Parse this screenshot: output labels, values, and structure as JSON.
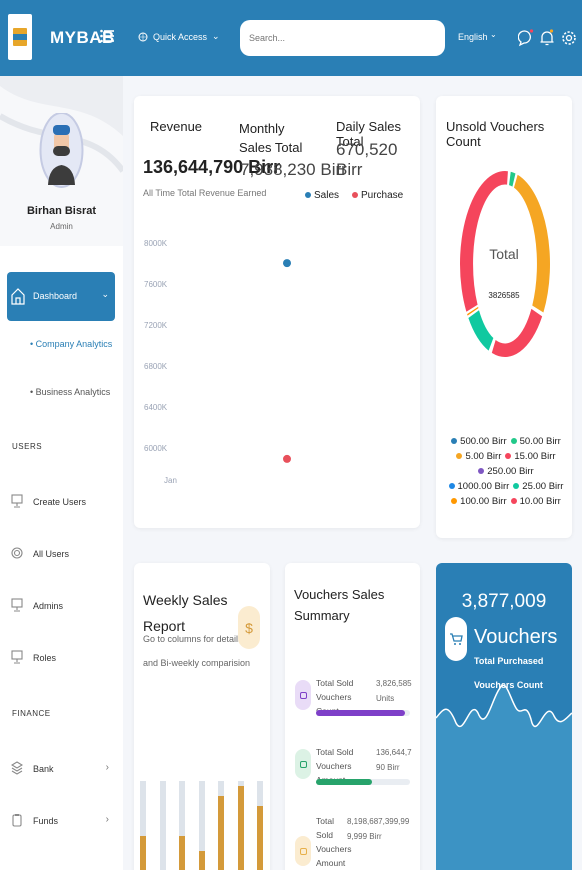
{
  "header": {
    "brand": "MYBAB",
    "quick_access": "Quick Access",
    "search_placeholder": "Search...",
    "language": "English"
  },
  "sidebar": {
    "user_name": "Birhan Bisrat",
    "user_role": "Admin",
    "dashboard_label": "Dashboard",
    "sub_items": [
      "Company Analytics",
      "Business Analytics"
    ],
    "sections": [
      "USERS",
      "FINANCE"
    ],
    "users_items": [
      "Create Users",
      "All Users",
      "Admins",
      "Roles"
    ],
    "finance_items": [
      "Bank",
      "Funds"
    ]
  },
  "revenue_card": {
    "revenue_label": "Revenue",
    "revenue_value": "136,644,790 Birr",
    "revenue_caption": "All Time Total Revenue Earned",
    "monthly_label": "Monthly Sales Total",
    "monthly_value": "7,938,230 Birr",
    "daily_label": "Daily Sales Total",
    "daily_value": "670,520 Birr"
  },
  "chart_data": [
    {
      "type": "scatter",
      "series": [
        {
          "name": "Sales",
          "color": "#2a7fb5",
          "points": [
            {
              "x": "Jan",
              "y": 7950
            }
          ]
        },
        {
          "name": "Purchase",
          "color": "#e8505b",
          "points": [
            {
              "x": "Jan",
              "y": 6040
            }
          ]
        }
      ],
      "categories": [
        "Jan"
      ],
      "y_ticks": [
        "8000K",
        "7600K",
        "7200K",
        "6800K",
        "6400K",
        "6000K"
      ],
      "ylim": [
        6000,
        8000
      ],
      "legend": "top-right",
      "grid": false
    },
    {
      "type": "pie",
      "title": "Unsold Vouchers Count",
      "center_label": "Total",
      "center_value": "3826585",
      "slices": [
        {
          "label": "500.00 Birr",
          "color": "#2a7fb5",
          "value": 0.2
        },
        {
          "label": "50.00 Birr",
          "color": "#22c98a",
          "value": 2.5
        },
        {
          "label": "5.00 Birr",
          "color": "#f5a623",
          "value": 30
        },
        {
          "label": "15.00 Birr",
          "color": "#f5455c",
          "value": 21
        },
        {
          "label": "250.00 Birr",
          "color": "#7e57c2",
          "value": 0.2
        },
        {
          "label": "1000.00 Birr",
          "color": "#1e88e5",
          "value": 0.2
        },
        {
          "label": "25.00 Birr",
          "color": "#10c9a0",
          "value": 10
        },
        {
          "label": "100.00 Birr",
          "color": "#ff9800",
          "value": 0.5
        },
        {
          "label": "10.00 Birr",
          "color": "#f5455c",
          "value": 35.4
        }
      ]
    },
    {
      "type": "bar",
      "title": "Weekly Sales Report",
      "subtitle": "Go to columns for details and Bi-weekly comparision",
      "values": [
        0.45,
        0.0,
        0.45,
        0.3,
        0.85,
        0.95,
        0.75
      ],
      "ylim": [
        0,
        1
      ]
    }
  ],
  "unsold_card": {
    "title": "Unsold Vouchers Count"
  },
  "weekly_card": {
    "title": "Weekly Sales Report",
    "caption1": "Go to columns for details",
    "caption2": "and Bi-weekly comparision",
    "icon": "dollar-icon"
  },
  "vouchers_summary": {
    "title": "Vouchers Sales Summary",
    "rows": [
      {
        "label": "Total Sold Vouchers Count",
        "value": "3,826,585 Units",
        "color": "#7e3fc8",
        "progress": 0.95
      },
      {
        "label": "Total Sold Vouchers Amount",
        "value": "136,644,790 Birr",
        "color": "#27a36b",
        "progress": 0.6
      },
      {
        "label": "Total Sold Vouchers Amount *",
        "value": "8,198,687,399,999,999 Birr",
        "color": "#e7b04a",
        "progress": 0.3
      }
    ]
  },
  "purchased_card": {
    "count": "3,877,009",
    "title": "Vouchers",
    "subtitle": "Total Purchased",
    "subtitle2": "Vouchers Count"
  },
  "colors": {
    "primary": "#2a7fb5",
    "accent": "#d49a3a"
  }
}
